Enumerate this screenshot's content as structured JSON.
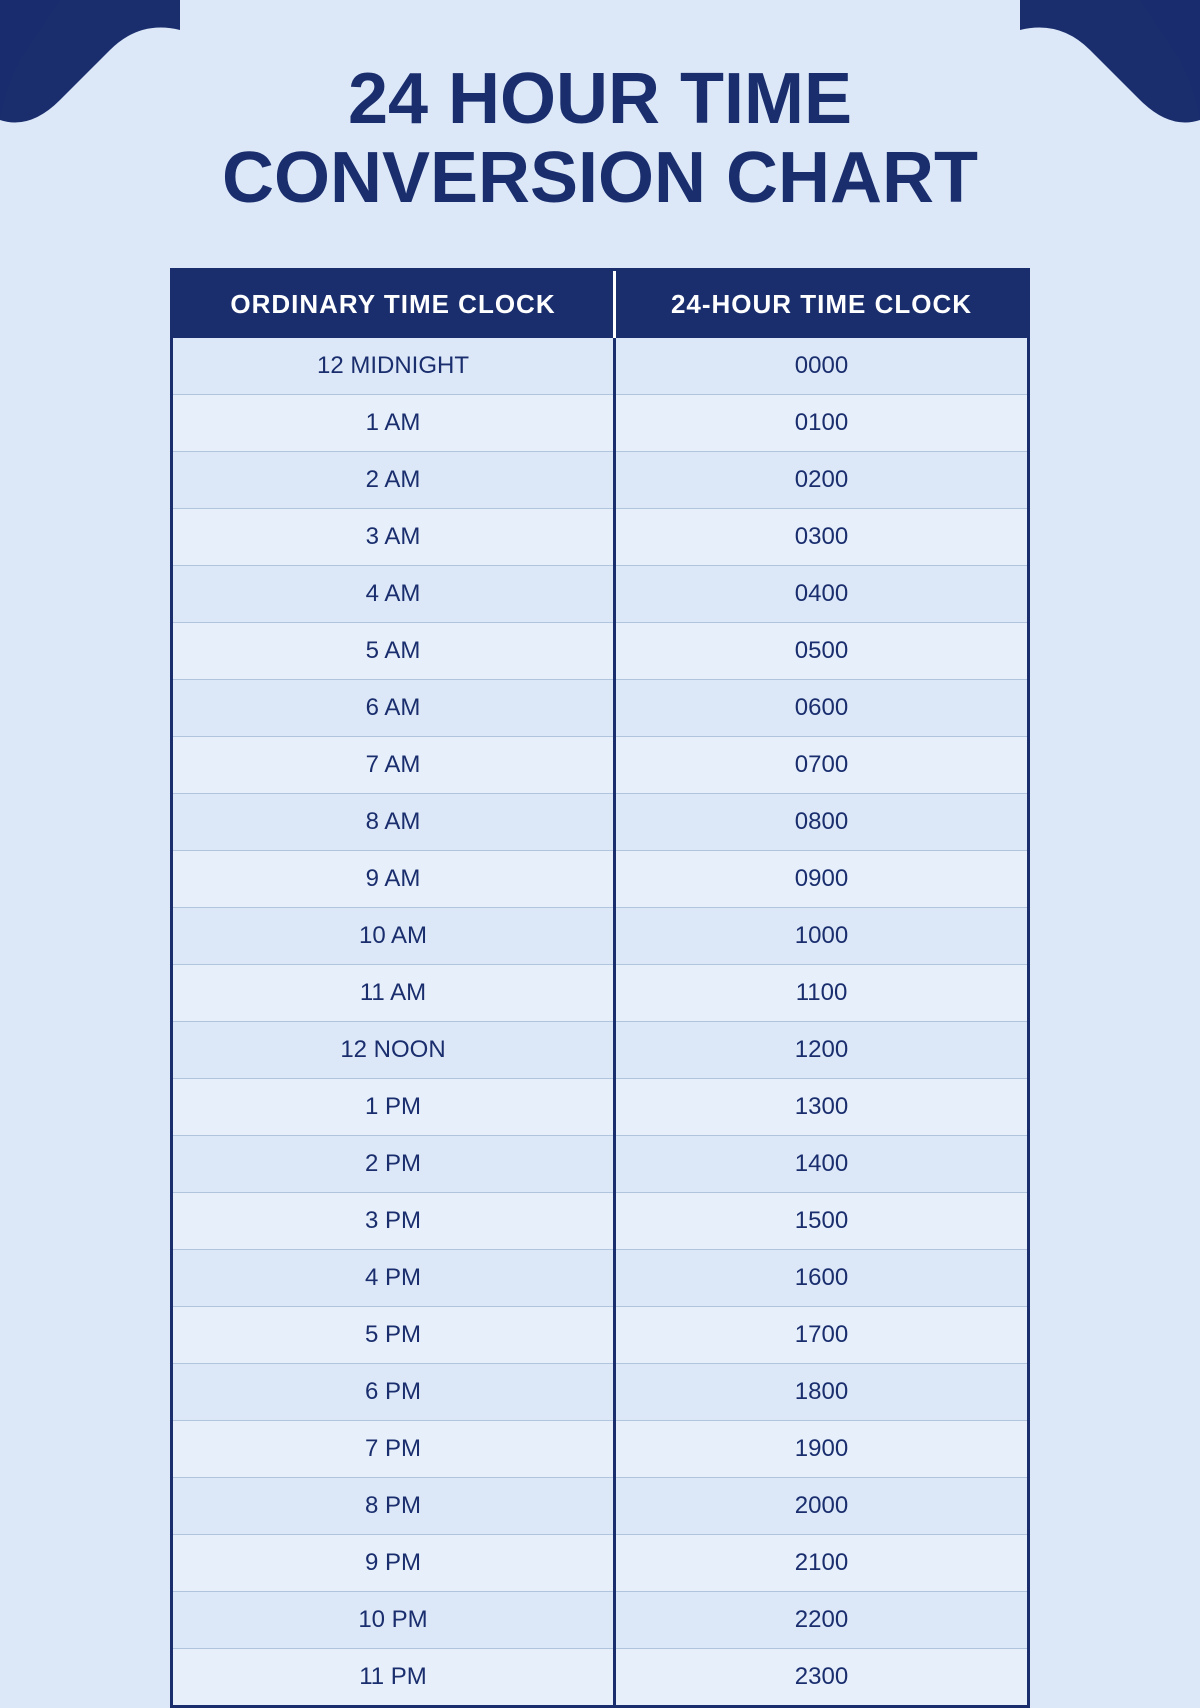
{
  "page": {
    "background_color": "#dce8f8",
    "title_line1": "24 HOUR TIME",
    "title_line2": "CONVERSION CHART"
  },
  "table": {
    "header": {
      "col1": "ORDINARY TIME CLOCK",
      "col2": "24-HOUR TIME CLOCK"
    },
    "rows": [
      {
        "ordinary": "12 MIDNIGHT",
        "military": "0000"
      },
      {
        "ordinary": "1 AM",
        "military": "0100"
      },
      {
        "ordinary": "2 AM",
        "military": "0200"
      },
      {
        "ordinary": "3 AM",
        "military": "0300"
      },
      {
        "ordinary": "4 AM",
        "military": "0400"
      },
      {
        "ordinary": "5 AM",
        "military": "0500"
      },
      {
        "ordinary": "6 AM",
        "military": "0600"
      },
      {
        "ordinary": "7 AM",
        "military": "0700"
      },
      {
        "ordinary": "8 AM",
        "military": "0800"
      },
      {
        "ordinary": "9 AM",
        "military": "0900"
      },
      {
        "ordinary": "10 AM",
        "military": "1000"
      },
      {
        "ordinary": "11 AM",
        "military": "1100"
      },
      {
        "ordinary": "12 NOON",
        "military": "1200"
      },
      {
        "ordinary": "1 PM",
        "military": "1300"
      },
      {
        "ordinary": "2 PM",
        "military": "1400"
      },
      {
        "ordinary": "3 PM",
        "military": "1500"
      },
      {
        "ordinary": "4 PM",
        "military": "1600"
      },
      {
        "ordinary": "5 PM",
        "military": "1700"
      },
      {
        "ordinary": "6 PM",
        "military": "1800"
      },
      {
        "ordinary": "7 PM",
        "military": "1900"
      },
      {
        "ordinary": "8 PM",
        "military": "2000"
      },
      {
        "ordinary": "9 PM",
        "military": "2100"
      },
      {
        "ordinary": "10 PM",
        "military": "2200"
      },
      {
        "ordinary": "11 PM",
        "military": "2300"
      }
    ]
  }
}
